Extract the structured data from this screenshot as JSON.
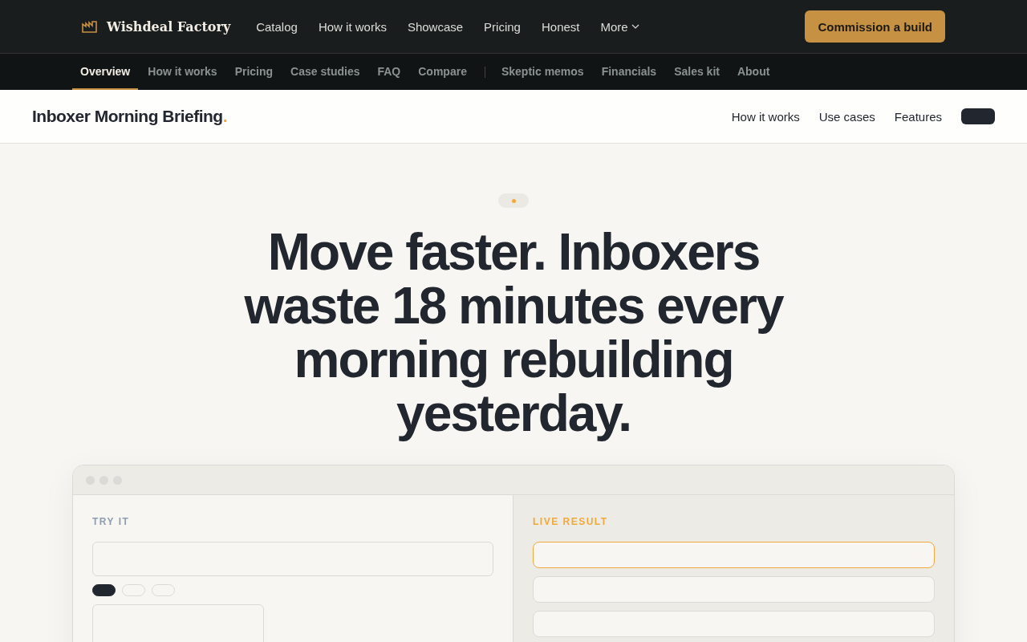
{
  "brand": {
    "name": "Wishdeal Factory"
  },
  "top_nav": {
    "items": [
      {
        "label": "Catalog"
      },
      {
        "label": "How it works"
      },
      {
        "label": "Showcase"
      },
      {
        "label": "Pricing"
      },
      {
        "label": "Honest"
      },
      {
        "label": "More",
        "kind": "dropdown"
      }
    ],
    "cta": "Commission a build"
  },
  "sub_nav": {
    "groups": [
      [
        {
          "label": "Overview",
          "selected": true
        },
        {
          "label": "How it works",
          "selected": false
        },
        {
          "label": "Pricing",
          "selected": false
        },
        {
          "label": "Case studies",
          "selected": false
        },
        {
          "label": "FAQ",
          "selected": false
        },
        {
          "label": "Compare",
          "selected": false
        }
      ],
      [
        {
          "label": "Skeptic memos",
          "selected": false
        },
        {
          "label": "Financials",
          "selected": false
        },
        {
          "label": "Sales kit",
          "selected": false
        },
        {
          "label": "About",
          "selected": false
        }
      ]
    ]
  },
  "product_bar": {
    "name": "Inboxer Morning Briefing",
    "dot": ".",
    "links": [
      "How it works",
      "Use cases",
      "Features"
    ]
  },
  "hero": {
    "headline": "Move faster. Inboxers waste 18 minutes every morning rebuilding yesterday."
  },
  "demo": {
    "left_label": "TRY IT",
    "pills": [
      {
        "selected": true
      },
      {
        "selected": false
      },
      {
        "selected": false
      }
    ],
    "right_label": "LIVE RESULT",
    "results": [
      {
        "selected": true
      },
      {
        "selected": false
      },
      {
        "selected": false
      }
    ]
  }
}
